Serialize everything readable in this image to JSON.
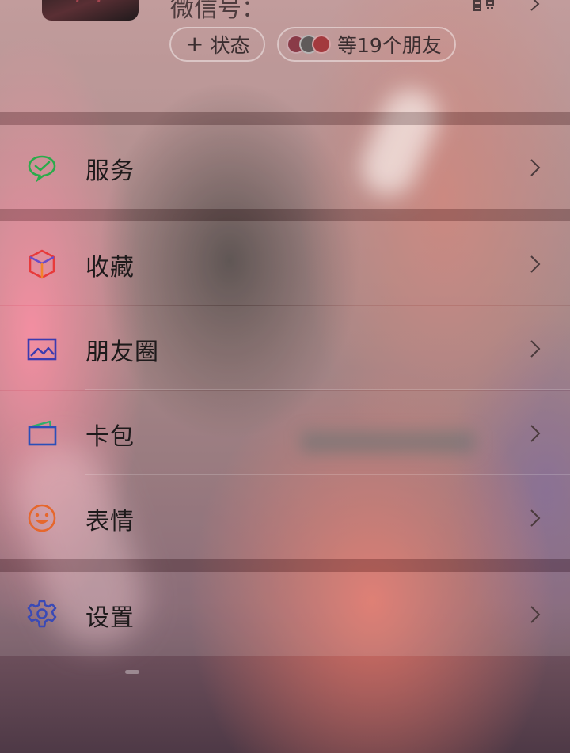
{
  "profile": {
    "wechat_id_label": "微信号：",
    "status_button_label": "状态",
    "friends_label": "等19个朋友",
    "mini_avatar_colors": [
      "#8a3b48",
      "#5f5a5a",
      "#a33a3e"
    ]
  },
  "menu": {
    "services": "服务",
    "favorites": "收藏",
    "moments": "朋友圈",
    "cards": "卡包",
    "stickers": "表情",
    "settings": "设置"
  },
  "icons": {
    "services": "wechat-pay-check-icon",
    "favorites": "cube-icon",
    "moments": "image-icon",
    "cards": "wallet-icon",
    "stickers": "smiley-icon",
    "settings": "gear-icon",
    "qr": "qr-code-icon",
    "chevron": "chevron-right-icon"
  },
  "colors": {
    "services_icon": "#2bab4b",
    "favorites_icon_a": "#e83a3a",
    "favorites_icon_b": "#6a4cc8",
    "moments_icon": "#3b3bb0",
    "cards_icon": "#2b4fb8",
    "stickers_icon": "#e6672c",
    "settings_icon": "#3a4ab6"
  }
}
